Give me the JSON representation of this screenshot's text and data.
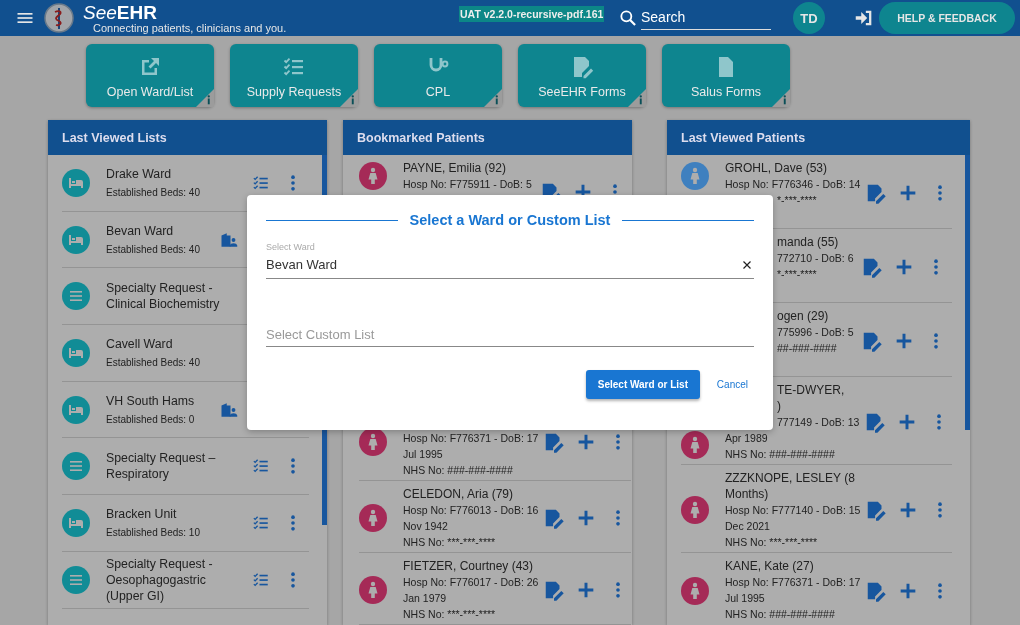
{
  "header": {
    "app_name": {
      "first": "See",
      "second": "EHR"
    },
    "tagline": "Connecting patients, clinicians and you.",
    "version": "UAT v2.2.0-recursive-pdf.161",
    "search": {
      "placeholder": "Search"
    },
    "user_initials": "TD",
    "help_button": "HELP & FEEDBACK"
  },
  "tiles": [
    {
      "label": "Open Ward/List",
      "kind": "open"
    },
    {
      "label": "Supply Requests",
      "kind": "checklist"
    },
    {
      "label": "CPL",
      "kind": "stethoscope"
    },
    {
      "label": "SeeEHR Forms",
      "kind": "form-edit"
    },
    {
      "label": "Salus Forms",
      "kind": "document"
    }
  ],
  "panels": [
    {
      "title": "Last Viewed Lists",
      "kind": "lists",
      "items": [
        {
          "title": "Drake Ward",
          "subtitle": "Established Beds: 40",
          "kind": "ward",
          "actions": [
            {
              "kind": "checklist"
            },
            {
              "kind": "more"
            }
          ]
        },
        {
          "title": "Bevan Ward",
          "subtitle": "Established Beds: 40",
          "kind": "ward",
          "actions": [
            {
              "kind": "ward-staff"
            }
          ]
        },
        {
          "title": "Specialty Request - Clinical Biochemistry",
          "kind": "list"
        },
        {
          "title": "Cavell Ward",
          "subtitle": "Established Beds: 40",
          "kind": "ward"
        },
        {
          "title": "VH South Hams",
          "subtitle": "Established Beds: 0",
          "kind": "ward",
          "actions": [
            {
              "kind": "ward-staff"
            }
          ]
        },
        {
          "title": "Specialty Request – Respiratory",
          "kind": "list",
          "actions": [
            {
              "kind": "checklist"
            },
            {
              "kind": "more"
            }
          ]
        },
        {
          "title": "Bracken Unit",
          "subtitle": "Established Beds: 10",
          "kind": "ward",
          "actions": [
            {
              "kind": "checklist"
            },
            {
              "kind": "more"
            }
          ]
        },
        {
          "title": "Specialty Request - Oesophagogastric (Upper GI)",
          "kind": "list",
          "actions": [
            {
              "kind": "checklist"
            },
            {
              "kind": "more"
            }
          ]
        }
      ]
    },
    {
      "title": "Bookmarked Patients",
      "kind": "patients",
      "row_groups": [
        [
          {
            "color": "#a52a57",
            "name_lines": [
              {
                "text": "PAYNE, Emilia (92)"
              }
            ],
            "lines": [
              {
                "text": "Hosp No: F775911 - DoB: 5"
              }
            ]
          }
        ],
        [
          {
            "color": "#a52a57",
            "lines": [
              {
                "text": "Hosp No: F776371 - DoB: 17"
              },
              {
                "text": "Jul 1995"
              },
              {
                "text": "NHS No: ###-###-####"
              }
            ]
          },
          {
            "color": "#a52a57",
            "name_lines": [
              {
                "text": "CELEDON, Aria (79)"
              }
            ],
            "lines": [
              {
                "text": "Hosp No: F776013 - DoB: 16"
              },
              {
                "text": "Nov 1942"
              },
              {
                "text": "NHS No: ***-***-****"
              }
            ]
          },
          {
            "color": "#a52a57",
            "name_lines": [
              {
                "text": "FIETZER, Courtney (43)"
              }
            ],
            "lines": [
              {
                "text": "Hosp No: F776017 - DoB: 26"
              },
              {
                "text": "Jan 1979"
              },
              {
                "text": "NHS No: ***-***-****"
              }
            ]
          }
        ]
      ]
    },
    {
      "title": "Last Viewed Patients",
      "kind": "patients",
      "row_groups": [
        [
          {
            "color": "#3f80bf",
            "name_lines": [
              {
                "text": "GROHL, Dave (53)"
              }
            ],
            "lines": [
              {
                "text": "Hosp No: F776346 - DoB: 14"
              },
              {
                "text": "*-***-****",
                "covered": true
              }
            ]
          },
          {
            "name_lines": [
              {
                "text": "manda (55)",
                "covered": true
              }
            ],
            "lines": [
              {
                "text": "772710 - DoB: 6",
                "covered": true
              },
              {
                "text": "*-***-****",
                "covered": true
              }
            ]
          },
          {
            "name_lines": [
              {
                "text": "ogen (29)",
                "covered": true
              }
            ],
            "lines": [
              {
                "text": "775996 - DoB: 5",
                "covered": true
              },
              {
                "text": "##-###-####",
                "covered": true
              }
            ]
          },
          {
            "color": "#a52a57",
            "name_lines": [
              {
                "text": "TE-DWYER,",
                "covered": true
              },
              {
                "text": ")",
                "covered": true
              }
            ],
            "lines": [
              {
                "text": "777149 - DoB: 13",
                "covered": true
              },
              {
                "text": "Apr 1989"
              },
              {
                "text": "NHS No: ###-###-####"
              }
            ]
          },
          {
            "color": "#a52a57",
            "name_lines": [
              {
                "text": "ZZZKNOPE, LESLEY (8 Months)"
              }
            ],
            "lines": [
              {
                "text": "Hosp No: F777140 - DoB: 15"
              },
              {
                "text": "Dec 2021"
              },
              {
                "text": "NHS No: ***-***-****"
              }
            ]
          },
          {
            "color": "#a52a57",
            "name_lines": [
              {
                "text": "KANE, Kate (27)"
              }
            ],
            "lines": [
              {
                "text": "Hosp No: F776371 - DoB: 17"
              },
              {
                "text": "Jul 1995"
              },
              {
                "text": "NHS No: ###-###-####"
              }
            ]
          }
        ]
      ]
    }
  ],
  "dialog": {
    "title": "Select a Ward or Custom List",
    "ward_select": {
      "label": "Select Ward",
      "value": "Bevan Ward"
    },
    "custom_list": {
      "placeholder": "Select Custom List"
    },
    "buttons": [
      {
        "label": "Select Ward or List",
        "kind": "primary"
      },
      {
        "label": "Cancel",
        "kind": "text"
      }
    ]
  }
}
